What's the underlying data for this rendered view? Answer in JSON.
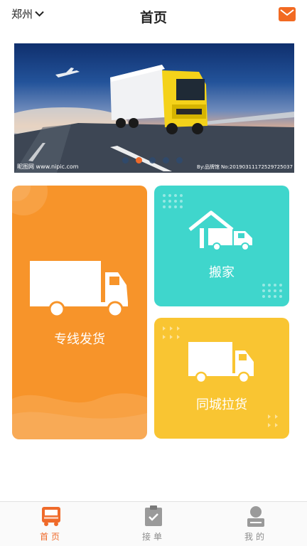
{
  "header": {
    "city": "郑州",
    "title": "首页"
  },
  "banner": {
    "watermark_left": "昵图网 www.nipic.com",
    "watermark_right": "By:品牌馆 No:20190311172529725037",
    "dots_count": 5,
    "active_dot": 2
  },
  "cards": {
    "main": {
      "label": "专线发货"
    },
    "move": {
      "label": "搬家"
    },
    "city": {
      "label": "同城拉货"
    }
  },
  "tabbar": {
    "tabs": [
      {
        "label": "首页",
        "icon": "truck-icon",
        "active": true
      },
      {
        "label": "接单",
        "icon": "clipboard-check-icon",
        "active": false
      },
      {
        "label": "我的",
        "icon": "user-icon",
        "active": false
      }
    ]
  },
  "colors": {
    "accent": "#ef6a2a",
    "card_orange": "#f7942a",
    "card_teal": "#3fd6cc",
    "card_yellow": "#f9c532"
  }
}
